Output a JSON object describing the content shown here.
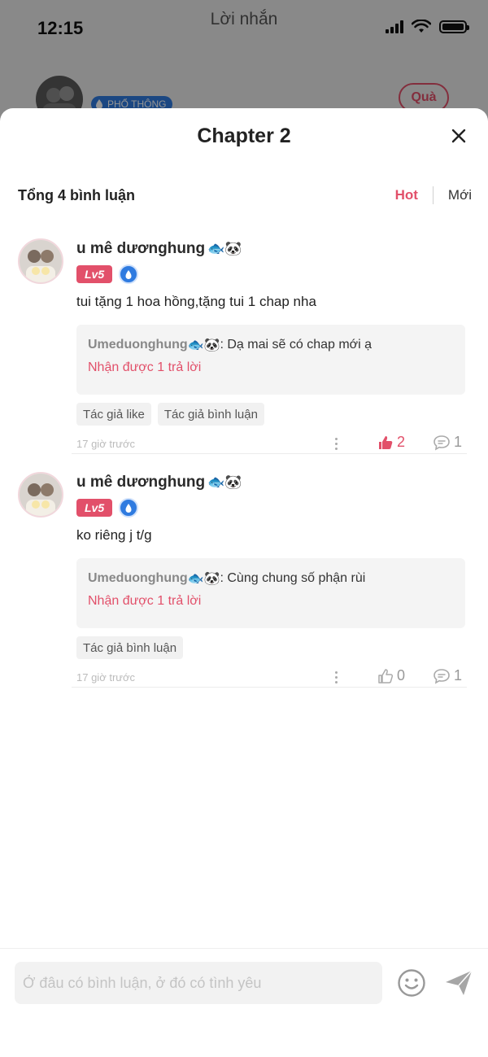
{
  "status_bar": {
    "time": "12:15"
  },
  "background": {
    "title": "Lời nhắn",
    "badge_label": "PHỔ THÔNG",
    "gift_label": "Quà"
  },
  "sheet": {
    "title": "Chapter 2",
    "summary": "Tổng 4 bình luận",
    "sort_tabs": [
      {
        "label": "Hot",
        "active": true
      },
      {
        "label": "Mới",
        "active": false
      }
    ]
  },
  "comments": [
    {
      "author": "u mê dươnghung",
      "author_emoji": "🐟🐼",
      "level": "Lv5",
      "text": "tui tặng 1 hoa hồng,tặng tui 1 chap nha",
      "reply_author": "Umeduonghung",
      "reply_emoji": "🐟🐼",
      "reply_text": ": Dạ mai sẽ có chap mới ạ",
      "reply_more": "Nhận được 1 trả lời",
      "tags": [
        "Tác giả like",
        "Tác giả bình luận"
      ],
      "time": "17 giờ trước",
      "likes": "2",
      "liked": true,
      "replies": "1"
    },
    {
      "author": "u mê dươnghung",
      "author_emoji": "🐟🐼",
      "level": "Lv5",
      "text": "ko riêng j t/g",
      "reply_author": "Umeduonghung",
      "reply_emoji": "🐟🐼",
      "reply_text": ": Cùng chung số phận rùi",
      "reply_more": "Nhận được 1 trả lời",
      "tags": [
        "Tác giả bình luận"
      ],
      "time": "17 giờ trước",
      "likes": "0",
      "liked": false,
      "replies": "1"
    }
  ],
  "input": {
    "placeholder": "Ở đâu có bình luận, ở đó có tình yêu"
  },
  "colors": {
    "accent": "#e2506a",
    "badge_blue": "#2f7be0"
  },
  "icons": [
    "close-icon",
    "water-drop-icon",
    "thumbs-up-icon",
    "comment-bubble-icon",
    "more-vertical-icon",
    "smiley-icon",
    "send-icon",
    "wifi-icon",
    "signal-icon",
    "battery-icon"
  ]
}
